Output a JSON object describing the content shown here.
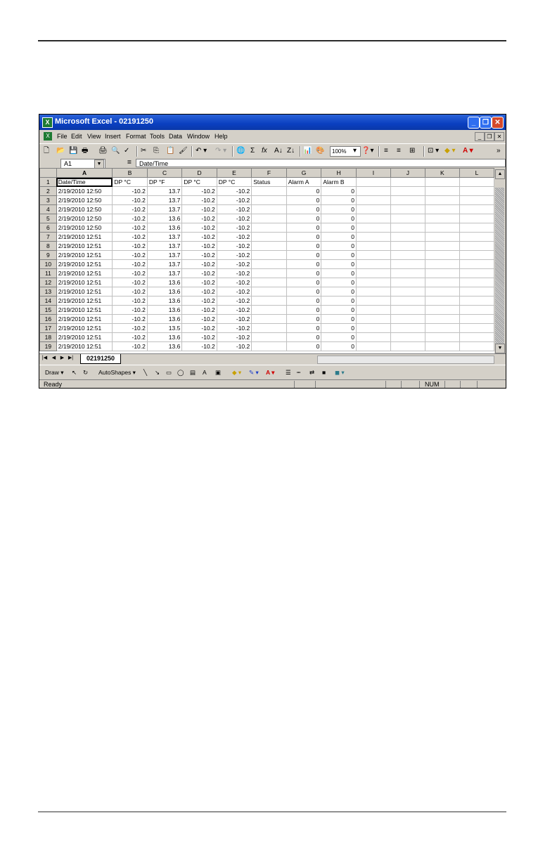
{
  "window": {
    "title": "Microsoft Excel - 02191250",
    "minimize": "_",
    "restore": "❐",
    "close": "✕"
  },
  "menu": [
    "File",
    "Edit",
    "View",
    "Insert",
    "Format",
    "Tools",
    "Data",
    "Window",
    "Help"
  ],
  "toolbar": {
    "zoom": "100%"
  },
  "formula_bar": {
    "cell_ref": "A1",
    "equals": "=",
    "content": "Date/Time"
  },
  "columns": [
    "A",
    "B",
    "C",
    "D",
    "E",
    "F",
    "G",
    "H",
    "I",
    "J",
    "K",
    "L"
  ],
  "header_row": [
    "Date/Time",
    "DP °C",
    "DP °F",
    "DP °C",
    "DP °C",
    "Status",
    "Alarm A",
    "Alarm B",
    "",
    "",
    "",
    ""
  ],
  "rows": [
    [
      "2/19/2010 12:50",
      "-10.2",
      "13.7",
      "-10.2",
      "-10.2",
      "",
      "0",
      "0"
    ],
    [
      "2/19/2010 12:50",
      "-10.2",
      "13.7",
      "-10.2",
      "-10.2",
      "",
      "0",
      "0"
    ],
    [
      "2/19/2010 12:50",
      "-10.2",
      "13.7",
      "-10.2",
      "-10.2",
      "",
      "0",
      "0"
    ],
    [
      "2/19/2010 12:50",
      "-10.2",
      "13.6",
      "-10.2",
      "-10.2",
      "",
      "0",
      "0"
    ],
    [
      "2/19/2010 12:50",
      "-10.2",
      "13.6",
      "-10.2",
      "-10.2",
      "",
      "0",
      "0"
    ],
    [
      "2/19/2010 12:51",
      "-10.2",
      "13.7",
      "-10.2",
      "-10.2",
      "",
      "0",
      "0"
    ],
    [
      "2/19/2010 12:51",
      "-10.2",
      "13.7",
      "-10.2",
      "-10.2",
      "",
      "0",
      "0"
    ],
    [
      "2/19/2010 12:51",
      "-10.2",
      "13.7",
      "-10.2",
      "-10.2",
      "",
      "0",
      "0"
    ],
    [
      "2/19/2010 12:51",
      "-10.2",
      "13.7",
      "-10.2",
      "-10.2",
      "",
      "0",
      "0"
    ],
    [
      "2/19/2010 12:51",
      "-10.2",
      "13.7",
      "-10.2",
      "-10.2",
      "",
      "0",
      "0"
    ],
    [
      "2/19/2010 12:51",
      "-10.2",
      "13.6",
      "-10.2",
      "-10.2",
      "",
      "0",
      "0"
    ],
    [
      "2/19/2010 12:51",
      "-10.2",
      "13.6",
      "-10.2",
      "-10.2",
      "",
      "0",
      "0"
    ],
    [
      "2/19/2010 12:51",
      "-10.2",
      "13.6",
      "-10.2",
      "-10.2",
      "",
      "0",
      "0"
    ],
    [
      "2/19/2010 12:51",
      "-10.2",
      "13.6",
      "-10.2",
      "-10.2",
      "",
      "0",
      "0"
    ],
    [
      "2/19/2010 12:51",
      "-10.2",
      "13.6",
      "-10.2",
      "-10.2",
      "",
      "0",
      "0"
    ],
    [
      "2/19/2010 12:51",
      "-10.2",
      "13.5",
      "-10.2",
      "-10.2",
      "",
      "0",
      "0"
    ],
    [
      "2/19/2010 12:51",
      "-10.2",
      "13.6",
      "-10.2",
      "-10.2",
      "",
      "0",
      "0"
    ],
    [
      "2/19/2010 12:51",
      "-10.2",
      "13.6",
      "-10.2",
      "-10.2",
      "",
      "0",
      "0"
    ]
  ],
  "sheet_tab": "02191250",
  "drawing_toolbar": {
    "draw": "Draw ▾",
    "autoshapes": "AutoShapes ▾"
  },
  "status": {
    "text": "Ready",
    "num": "NUM"
  },
  "colors": {
    "title_bar": "#0a3fc0",
    "chrome": "#d4d0c8",
    "excel_green": "#1d7a32"
  }
}
